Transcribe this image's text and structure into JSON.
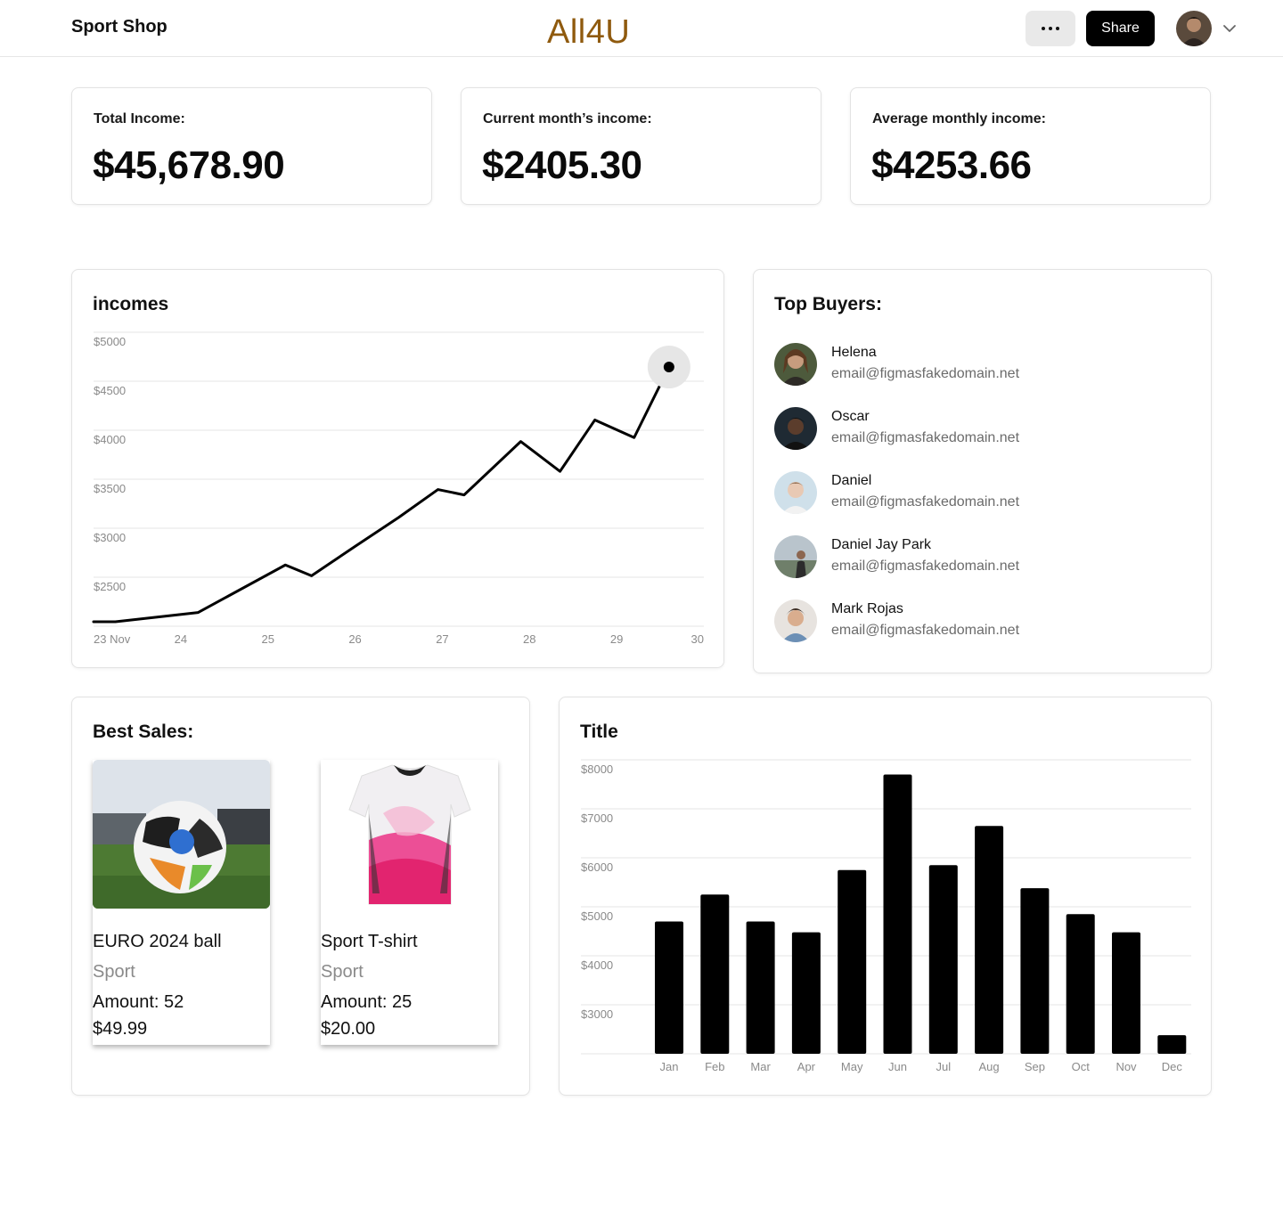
{
  "header": {
    "brand": "Sport Shop",
    "logo": "All4U",
    "more_icon": "more-horizontal-icon",
    "share_label": "Share",
    "chevron_icon": "chevron-down-icon"
  },
  "stats": [
    {
      "label": "Total Income:",
      "value": "$45,678.90"
    },
    {
      "label": "Current month’s income:",
      "value": "$2405.30"
    },
    {
      "label": "Average monthly income:",
      "value": "$4253.66"
    }
  ],
  "incomes_chart": {
    "title": "incomes",
    "chart_data": {
      "type": "line",
      "x_tick_labels": [
        "23 Nov",
        "24",
        "25",
        "26",
        "27",
        "28",
        "29",
        "30"
      ],
      "y_tick_labels": [
        "$5000",
        "$4500",
        "$4000",
        "$3500",
        "$3000",
        "$2500"
      ],
      "ylim": [
        2000,
        5000
      ],
      "xlim": [
        23,
        30
      ],
      "x": [
        23,
        23.25,
        24.2,
        25.2,
        25.5,
        26.0,
        26.5,
        26.95,
        27.25,
        27.9,
        28.35,
        28.75,
        29.2,
        29.6
      ],
      "y": [
        2045,
        2045,
        2140,
        2625,
        2515,
        2815,
        3110,
        3395,
        3340,
        3885,
        3580,
        4105,
        3925,
        4645
      ],
      "highlight_point": {
        "x": 29.6,
        "y": 4645
      },
      "grid": true,
      "line_color": "#000000",
      "highlight_color": "#e6e6e6"
    }
  },
  "top_buyers": {
    "title": "Top Buyers:",
    "items": [
      {
        "name": "Helena",
        "email": "email@figmasfakedomain.net"
      },
      {
        "name": "Oscar",
        "email": "email@figmasfakedomain.net"
      },
      {
        "name": "Daniel",
        "email": "email@figmasfakedomain.net"
      },
      {
        "name": "Daniel Jay Park",
        "email": "email@figmasfakedomain.net"
      },
      {
        "name": "Mark Rojas",
        "email": "email@figmasfakedomain.net"
      }
    ]
  },
  "best_sales": {
    "title": "Best Sales:",
    "items": [
      {
        "name": "EURO 2024 ball",
        "category": "Sport",
        "amount": "Amount: 52",
        "price": "$49.99"
      },
      {
        "name": "Sport T-shirt",
        "category": "Sport",
        "amount": "Amount: 25",
        "price": "$20.00"
      }
    ]
  },
  "monthly_chart": {
    "title": "Title",
    "chart_data": {
      "type": "bar",
      "categories": [
        "Jan",
        "Feb",
        "Mar",
        "Apr",
        "May",
        "Jun",
        "Jul",
        "Aug",
        "Sep",
        "Oct",
        "Nov",
        "Dec"
      ],
      "values": [
        4700,
        5250,
        4700,
        4480,
        5750,
        7700,
        5850,
        6650,
        5380,
        4850,
        4480,
        2380
      ],
      "y_tick_labels": [
        "$8000",
        "$7000",
        "$6000",
        "$5000",
        "$4000",
        "$3000"
      ],
      "ylim": [
        2000,
        8000
      ],
      "grid": true,
      "bar_color": "#000000"
    }
  }
}
